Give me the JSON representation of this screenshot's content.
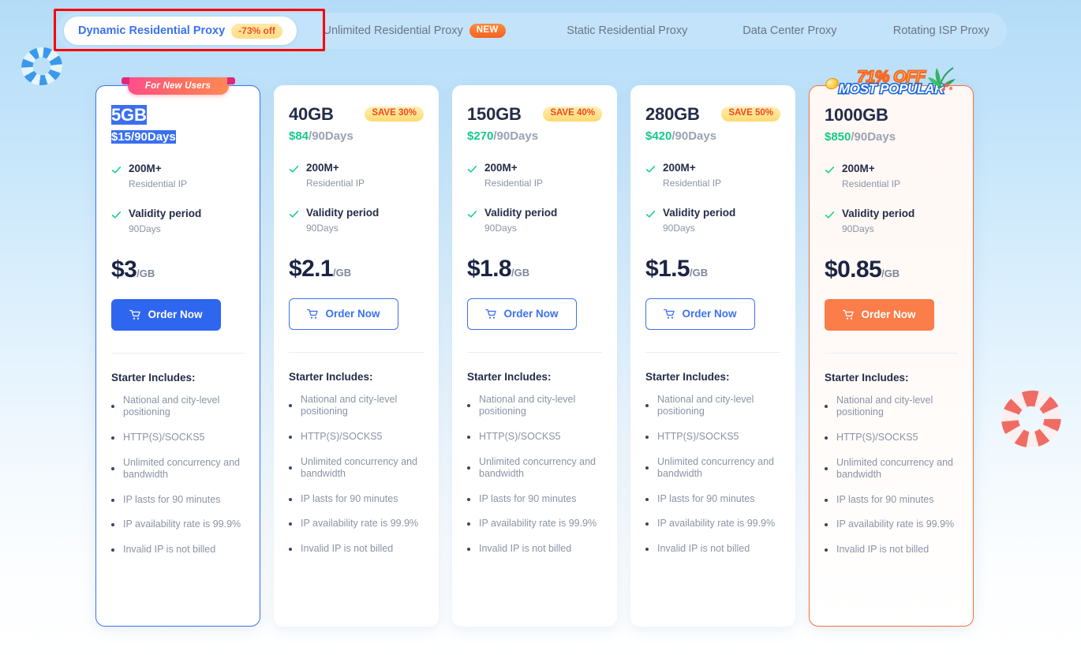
{
  "tabs": [
    {
      "label": "Dynamic Residential Proxy",
      "badge": "-73% off",
      "badge_kind": "off",
      "active": true
    },
    {
      "label": "Unlimited Residential Proxy",
      "badge": "NEW",
      "badge_kind": "new",
      "active": false
    },
    {
      "label": "Static Residential Proxy",
      "badge": "",
      "badge_kind": "",
      "active": false
    },
    {
      "label": "Data Center Proxy",
      "badge": "",
      "badge_kind": "",
      "active": false
    },
    {
      "label": "Rotating ISP Proxy",
      "badge": "",
      "badge_kind": "",
      "active": false
    }
  ],
  "colors": {
    "accent_blue": "#3b72f0",
    "accent_orange": "#fa7d4a",
    "price_green": "#17c98b",
    "badge_gold": "#ffd970",
    "badge_text": "#f2471f",
    "annotation_red": "#ff0000",
    "selection_blue": "#3a6ff0"
  },
  "annotation": {
    "shape": "rectangle",
    "target": "tab-dynamic-residential-proxy"
  },
  "decorations": {
    "ring_left": "life-ring-blue",
    "ring_right": "life-ring-red",
    "palm": "palm-leaf",
    "coin": "gold-coin"
  },
  "plans": [
    {
      "size": "5GB",
      "save_badge": "",
      "ribbon": "For New Users",
      "term_price": "$15",
      "term_rest": "/90Days",
      "selected": true,
      "highlight": "first",
      "features": [
        {
          "title": "200M+",
          "sub": "Residential IP"
        },
        {
          "title": "Validity period",
          "sub": "90Days"
        }
      ],
      "unit_amount": "$3",
      "unit_per": "/GB",
      "order_label": "Order Now",
      "order_style": "solid-blue",
      "includes_title": "Starter Includes:",
      "includes": [
        "National and city-level positioning",
        "HTTP(S)/SOCKS5",
        "Unlimited concurrency and bandwidth",
        "IP lasts for 90 minutes",
        "IP availability rate is 99.9%",
        "Invalid IP is not billed"
      ]
    },
    {
      "size": "40GB",
      "save_badge": "SAVE 30%",
      "ribbon": "",
      "term_price": "$84",
      "term_rest": "/90Days",
      "selected": false,
      "highlight": "",
      "features": [
        {
          "title": "200M+",
          "sub": "Residential IP"
        },
        {
          "title": "Validity period",
          "sub": "90Days"
        }
      ],
      "unit_amount": "$2.1",
      "unit_per": "/GB",
      "order_label": "Order Now",
      "order_style": "outline",
      "includes_title": "Starter Includes:",
      "includes": [
        "National and city-level positioning",
        "HTTP(S)/SOCKS5",
        "Unlimited concurrency and bandwidth",
        "IP lasts for 90 minutes",
        "IP availability rate is 99.9%",
        "Invalid IP is not billed"
      ]
    },
    {
      "size": "150GB",
      "save_badge": "SAVE 40%",
      "ribbon": "",
      "term_price": "$270",
      "term_rest": "/90Days",
      "selected": false,
      "highlight": "",
      "features": [
        {
          "title": "200M+",
          "sub": "Residential IP"
        },
        {
          "title": "Validity period",
          "sub": "90Days"
        }
      ],
      "unit_amount": "$1.8",
      "unit_per": "/GB",
      "order_label": "Order Now",
      "order_style": "outline",
      "includes_title": "Starter Includes:",
      "includes": [
        "National and city-level positioning",
        "HTTP(S)/SOCKS5",
        "Unlimited concurrency and bandwidth",
        "IP lasts for 90 minutes",
        "IP availability rate is 99.9%",
        "Invalid IP is not billed"
      ]
    },
    {
      "size": "280GB",
      "save_badge": "SAVE 50%",
      "ribbon": "",
      "term_price": "$420",
      "term_rest": "/90Days",
      "selected": false,
      "highlight": "",
      "features": [
        {
          "title": "200M+",
          "sub": "Residential IP"
        },
        {
          "title": "Validity period",
          "sub": "90Days"
        }
      ],
      "unit_amount": "$1.5",
      "unit_per": "/GB",
      "order_label": "Order Now",
      "order_style": "outline",
      "includes_title": "Starter Includes:",
      "includes": [
        "National and city-level positioning",
        "HTTP(S)/SOCKS5",
        "Unlimited concurrency and bandwidth",
        "IP lasts for 90 minutes",
        "IP availability rate is 99.9%",
        "Invalid IP is not billed"
      ]
    },
    {
      "size": "1000GB",
      "save_badge": "",
      "ribbon": "",
      "topper_off": "71% OFF",
      "topper_popular": "MOST POPULAR",
      "term_price": "$850",
      "term_rest": "/90Days",
      "selected": false,
      "highlight": "popular",
      "features": [
        {
          "title": "200M+",
          "sub": "Residential IP"
        },
        {
          "title": "Validity period",
          "sub": "90Days"
        }
      ],
      "unit_amount": "$0.85",
      "unit_per": "/GB",
      "order_label": "Order Now",
      "order_style": "solid-orange",
      "includes_title": "Starter Includes:",
      "includes": [
        "National and city-level positioning",
        "HTTP(S)/SOCKS5",
        "Unlimited concurrency and bandwidth",
        "IP lasts for 90 minutes",
        "IP availability rate is 99.9%",
        "Invalid IP is not billed"
      ]
    }
  ]
}
